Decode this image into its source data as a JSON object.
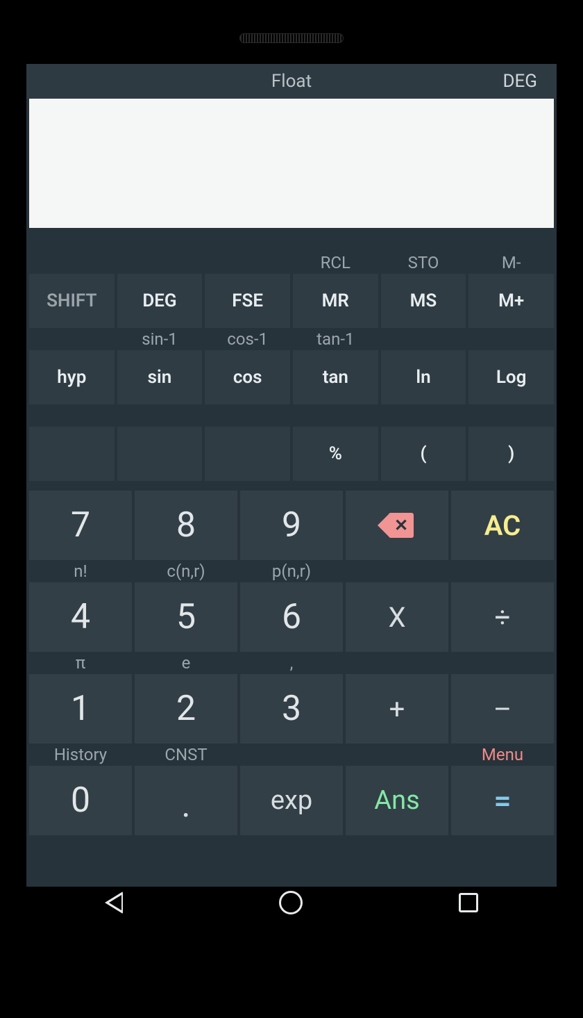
{
  "statusbar": {
    "mode": "Float",
    "angle": "DEG"
  },
  "display": {
    "value": ""
  },
  "sup1": {
    "c3": "RCL",
    "c4": "STO",
    "c5": "M-"
  },
  "r1": {
    "shift": "SHIFT",
    "deg": "DEG",
    "fse": "FSE",
    "mr": "MR",
    "ms": "MS",
    "mplus": "M+"
  },
  "sup2": {
    "c1": "sin-1",
    "c2": "cos-1",
    "c3": "tan-1"
  },
  "r2": {
    "hyp": "hyp",
    "sin": "sin",
    "cos": "cos",
    "tan": "tan",
    "ln": "ln",
    "log": "Log"
  },
  "r3": {
    "pct": "%",
    "lp": "(",
    "rp": ")"
  },
  "r4": {
    "d7": "7",
    "d8": "8",
    "d9": "9",
    "ac": "AC"
  },
  "sup4": {
    "c0": "n!",
    "c1": "c(n,r)",
    "c2": "p(n,r)"
  },
  "r5": {
    "d4": "4",
    "d5": "5",
    "d6": "6",
    "mul": "X",
    "div": "÷"
  },
  "sup5": {
    "c0": "π",
    "c1": "e",
    "c2": ","
  },
  "r6": {
    "d1": "1",
    "d2": "2",
    "d3": "3",
    "add": "+",
    "sub": "–"
  },
  "sup6": {
    "c0": "History",
    "c1": "CNST",
    "c4": "Menu"
  },
  "r7": {
    "d0": "0",
    "dot": ".",
    "exp": "exp",
    "ans": "Ans",
    "eq": "="
  }
}
